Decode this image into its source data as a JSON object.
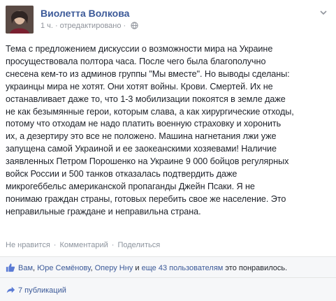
{
  "post": {
    "author": "Виолетта Волкова",
    "time": "1 ч.",
    "separator": "·",
    "edited": "отредактировано",
    "text": "Тема с предложением дискуссии о возможности мира на Украине\nпросуществовала полтора часа. После чего была благополучно\nснесена кем-то из админов группы \"Мы вместе\". Но выводы сделаны:\nукраинцы мира не хотят. Они хотят войны. Крови. Смертей. Их не\nостанавливает даже то, что 1-3 мобилизации покоятся в земле даже\nне как безымянные герои, которым слава, а как хирургические отходы,\nпотому что отходам не надо платить военную страховку и хоронить\nих, а дезертиру это все не положено. Машина нагнетания лжи уже\nзапущена самой Украиной и ее заокеанскими хозяевами! Наличие\nзаявленных Петром Порошенко на Украине 9 000 бойцов регулярных\nвойск России и 500 танков отказалась подтвердить даже\nмикрогеббельс американской пропаганды Джейн Псаки. Я не\nпонимаю граждан страны, готовых перебить свое же население. Это\nнеправильные граждане и неправильна страна."
  },
  "actions": {
    "unlike": "Не нравится",
    "comment": "Комментарий",
    "share": "Поделиться",
    "dot": "·"
  },
  "likes": {
    "you": "Вам",
    "comma": ",",
    "person1": "Юре Семёнову",
    "person2": "Оперу Нну",
    "and": "и",
    "others": "еще 43 пользователям",
    "suffix": "это понравилось."
  },
  "shares": {
    "label": "7 публикаций"
  },
  "colors": {
    "link": "#3b5998",
    "muted": "#90949c",
    "text": "#1d2129"
  },
  "icons": {
    "globe": "globe-icon",
    "chevron": "chevron-down-icon",
    "like": "thumbs-up-icon",
    "share": "share-arrow-icon"
  }
}
